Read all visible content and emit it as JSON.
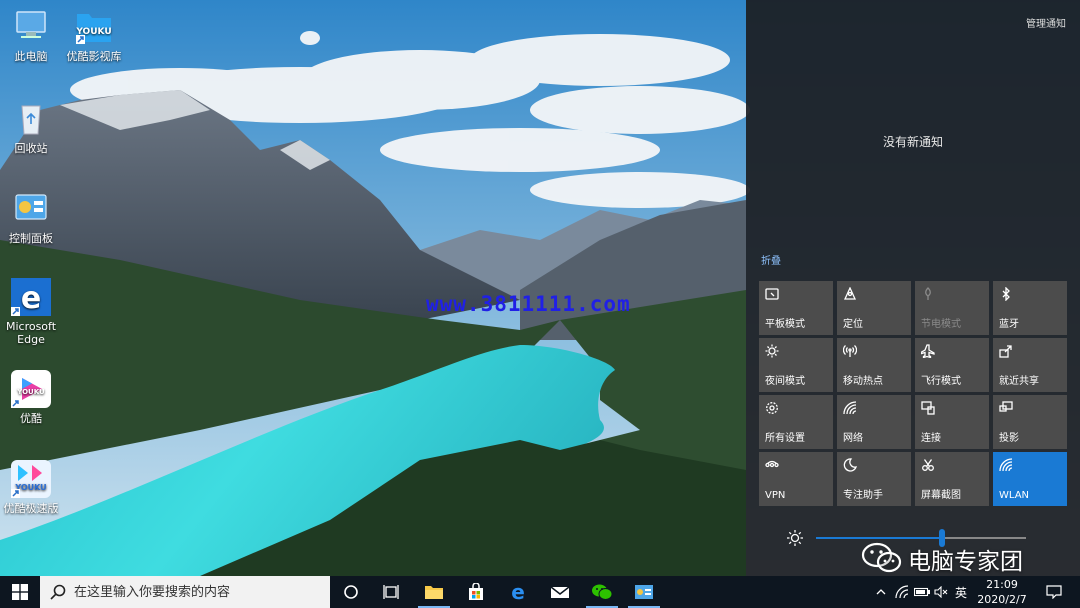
{
  "watermark": {
    "url": "www.3811111.com",
    "brand": "电脑专家团"
  },
  "desktop": {
    "icons": [
      {
        "label": "此电脑"
      },
      {
        "label": "优酷影视库"
      },
      {
        "label": "回收站"
      },
      {
        "label": "控制面板"
      },
      {
        "label": "Microsoft Edge"
      },
      {
        "label": "优酷"
      },
      {
        "label": "优酷极速版"
      }
    ]
  },
  "action_center": {
    "manage_notifications": "管理通知",
    "no_notifications": "没有新通知",
    "collapse": "折叠",
    "tiles": [
      {
        "label": "平板模式",
        "icon": "tablet-mode-icon",
        "state": "off"
      },
      {
        "label": "定位",
        "icon": "location-icon",
        "state": "off"
      },
      {
        "label": "节电模式",
        "icon": "battery-saver-icon",
        "state": "disabled"
      },
      {
        "label": "蓝牙",
        "icon": "bluetooth-icon",
        "state": "off"
      },
      {
        "label": "夜间模式",
        "icon": "night-light-icon",
        "state": "off"
      },
      {
        "label": "移动热点",
        "icon": "mobile-hotspot-icon",
        "state": "off"
      },
      {
        "label": "飞行模式",
        "icon": "airplane-icon",
        "state": "off"
      },
      {
        "label": "就近共享",
        "icon": "nearby-share-icon",
        "state": "off"
      },
      {
        "label": "所有设置",
        "icon": "settings-icon",
        "state": "off"
      },
      {
        "label": "网络",
        "icon": "network-icon",
        "state": "off"
      },
      {
        "label": "连接",
        "icon": "connect-icon",
        "state": "off"
      },
      {
        "label": "投影",
        "icon": "project-icon",
        "state": "off"
      },
      {
        "label": "VPN",
        "icon": "vpn-icon",
        "state": "off"
      },
      {
        "label": "专注助手",
        "icon": "focus-assist-icon",
        "state": "off"
      },
      {
        "label": "屏幕截图",
        "icon": "screen-snip-icon",
        "state": "off"
      },
      {
        "label": "WLAN",
        "icon": "wifi-icon",
        "state": "on"
      }
    ],
    "brightness_level": 0.6,
    "accent_color": "#1a7ad4"
  },
  "taskbar": {
    "search_placeholder": "在这里输入你要搜索的内容",
    "ime_label": "英",
    "time": "21:09",
    "date": "2020/2/7"
  }
}
